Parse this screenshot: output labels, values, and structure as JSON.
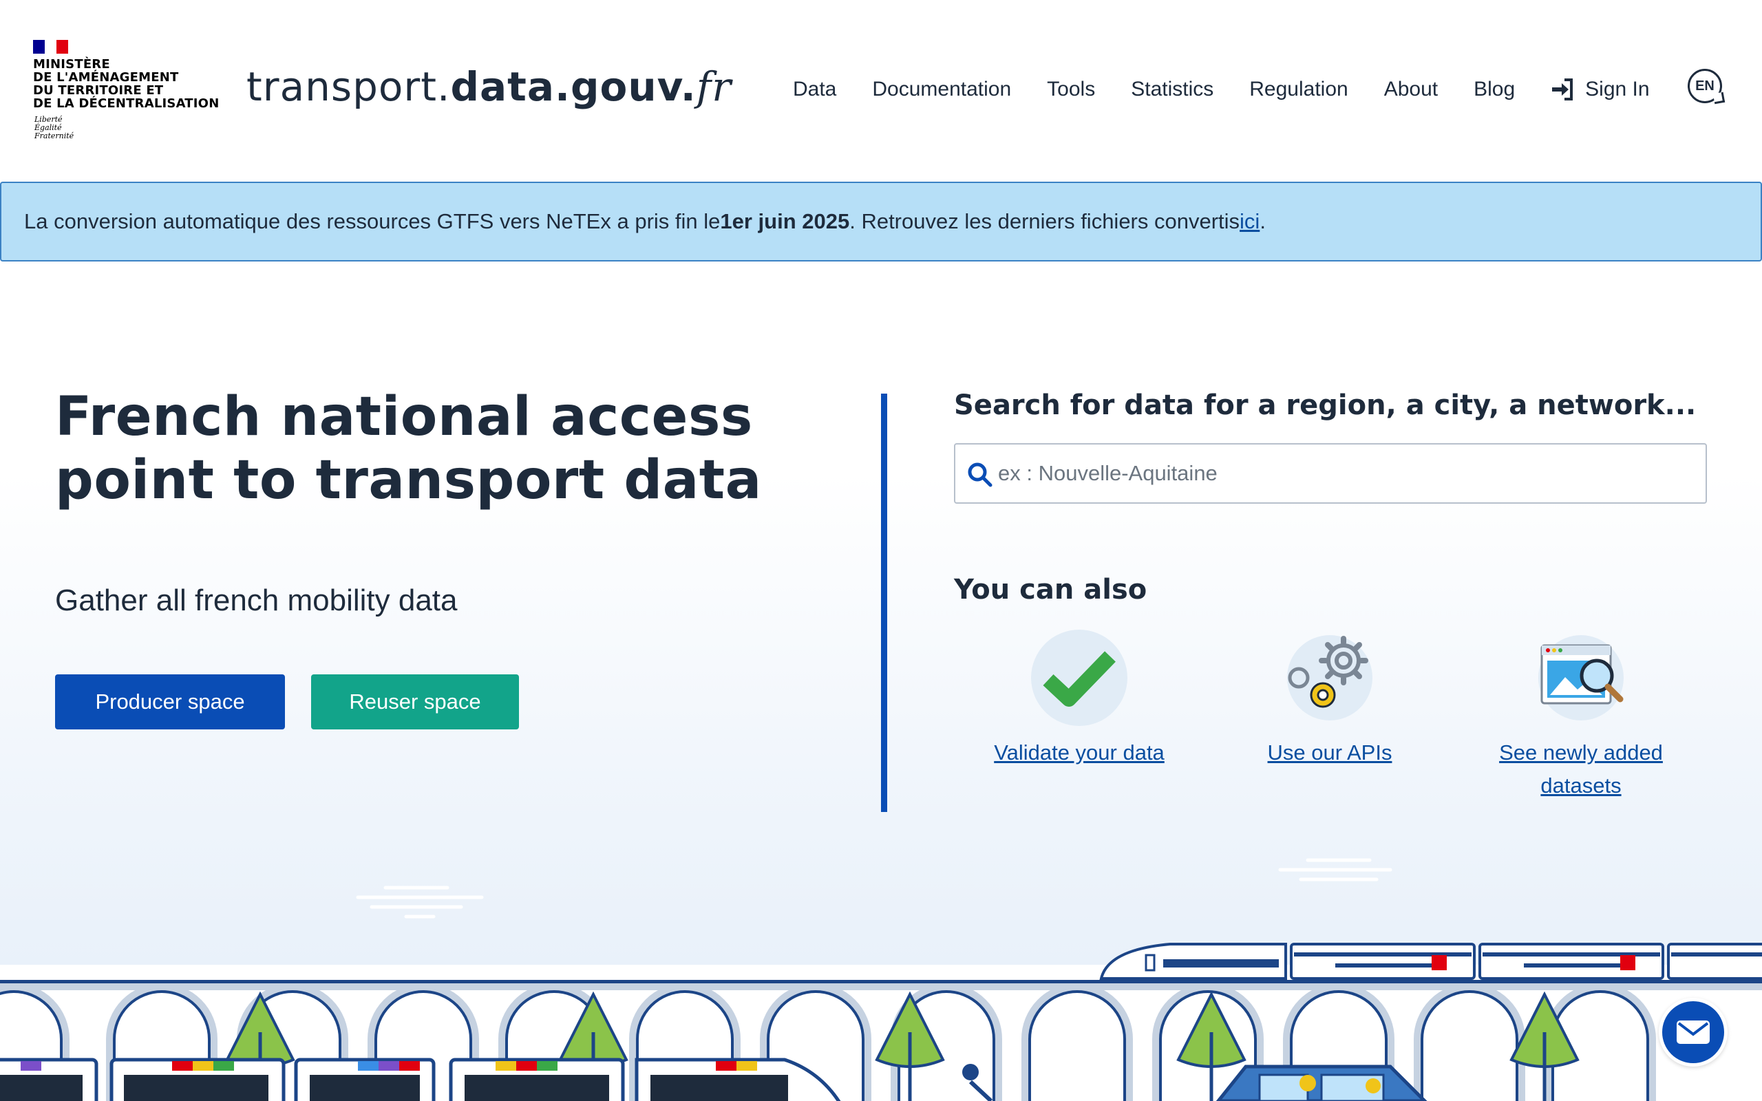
{
  "header": {
    "ministry": "MINISTÈRE\nDE L'AMÉNAGEMENT\nDU TERRITOIRE ET\nDE LA DÉCENTRALISATION",
    "motto": "Liberté\nÉgalité\nFraternité",
    "site_title_part1": "transport.",
    "site_title_part2": "data.gouv.",
    "site_title_part3": "fr",
    "nav": [
      "Data",
      "Documentation",
      "Tools",
      "Statistics",
      "Regulation",
      "About",
      "Blog"
    ],
    "sign_in": "Sign In",
    "lang": "EN"
  },
  "notice": {
    "text_before": "La conversion automatique des ressources GTFS vers NeTEx a pris fin le ",
    "date": "1er juin 2025",
    "text_after": ". Retrouvez les derniers fichiers convertis ",
    "link": "ici",
    "end": "."
  },
  "hero": {
    "title": "French national access point to transport data",
    "subtitle": "Gather all french mobility data",
    "producer_button": "Producer space",
    "reuser_button": "Reuser space"
  },
  "search": {
    "title": "Search for data for a region, a city, a network...",
    "placeholder": "ex : Nouvelle-Aquitaine"
  },
  "also": {
    "title": "You can also",
    "items": [
      {
        "label": "Validate your data",
        "icon": "checkmark-icon"
      },
      {
        "label": "Use our APIs",
        "icon": "gears-icon"
      },
      {
        "label": "See newly added datasets",
        "icon": "dataset-search-icon"
      }
    ]
  },
  "colors": {
    "primary": "#0a4db5",
    "reuser": "#12a48a",
    "notice_bg": "#b6dff7",
    "text": "#1e2b3c"
  }
}
